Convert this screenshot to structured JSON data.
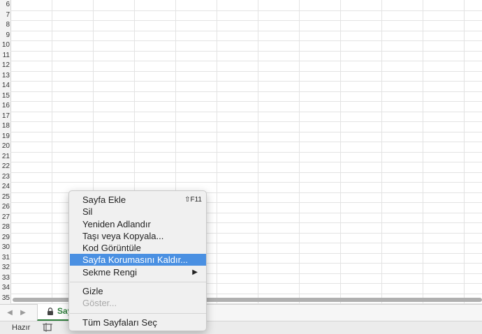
{
  "rows": [
    "6",
    "7",
    "8",
    "9",
    "10",
    "11",
    "12",
    "13",
    "14",
    "15",
    "16",
    "17",
    "18",
    "19",
    "20",
    "21",
    "22",
    "23",
    "24",
    "25",
    "26",
    "27",
    "28",
    "29",
    "30",
    "31",
    "32",
    "33",
    "34",
    "35"
  ],
  "sheet_tab": {
    "name": "Sayfa1",
    "visible_text": "Say"
  },
  "status": {
    "ready": "Hazır"
  },
  "context_menu": {
    "items": [
      {
        "label": "Sayfa Ekle",
        "shortcut": "⇧F11"
      },
      {
        "label": "Sil"
      },
      {
        "label": "Yeniden Adlandır"
      },
      {
        "label": "Taşı veya Kopyala..."
      },
      {
        "label": "Kod Görüntüle"
      },
      {
        "label": "Sayfa Korumasını Kaldır...",
        "selected": true
      },
      {
        "label": "Sekme Rengi",
        "submenu_arrow": "▶"
      },
      {
        "label": "Gizle"
      },
      {
        "label": "Göster...",
        "disabled": true
      },
      {
        "label": "Tüm Sayfaları Seç"
      }
    ]
  },
  "icons": {
    "nav_prev": "chevron-left-icon",
    "nav_next": "chevron-right-icon",
    "lock": "lock-icon",
    "page_layout": "page-layout-icon"
  },
  "colors": {
    "selection": "#4a90e2",
    "sheet_tab_text": "#2d7d3a"
  }
}
